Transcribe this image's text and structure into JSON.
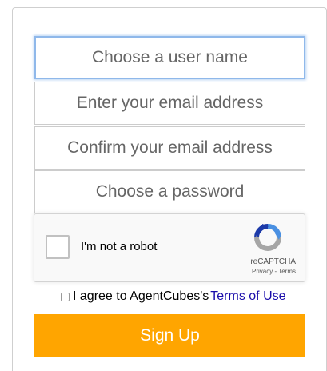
{
  "form": {
    "username_placeholder": "Choose a user name",
    "email_placeholder": "Enter your email address",
    "confirm_email_placeholder": "Confirm your email address",
    "password_placeholder": "Choose a password"
  },
  "recaptcha": {
    "label": "I'm not a robot",
    "brand": "reCAPTCHA",
    "privacy_link": "Privacy",
    "separator": " - ",
    "terms_link": "Terms",
    "checked": false
  },
  "agreement": {
    "text": "I agree to AgentCubes's",
    "link": "Terms of Use",
    "checked": false
  },
  "signup_button": {
    "label": "Sign Up"
  },
  "colors": {
    "button": "#ffa500",
    "focus_border": "#8fb8ea",
    "link": "#1a0dab",
    "recaptcha_blue": "#4a90e2",
    "recaptcha_gray": "#a6a6a6"
  }
}
